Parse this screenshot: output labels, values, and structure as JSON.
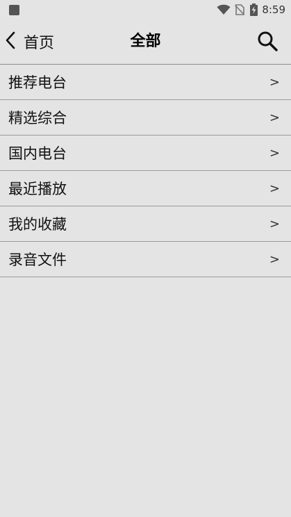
{
  "status_bar": {
    "time": "8:59",
    "icons": [
      "notification-square-icon",
      "wifi-icon",
      "no-sim-icon",
      "battery-charging-icon"
    ]
  },
  "toolbar": {
    "back_label": "首页",
    "title": "全部",
    "back_icon": "chevron-left-icon",
    "search_icon": "search-icon"
  },
  "menu": {
    "chevron": ">",
    "items": [
      {
        "label": "推荐电台"
      },
      {
        "label": "精选综合"
      },
      {
        "label": "国内电台"
      },
      {
        "label": "最近播放"
      },
      {
        "label": "我的收藏"
      },
      {
        "label": "录音文件"
      }
    ]
  },
  "colors": {
    "background": "#e4e4e4",
    "divider": "#9a9a9a",
    "text": "#111111"
  }
}
